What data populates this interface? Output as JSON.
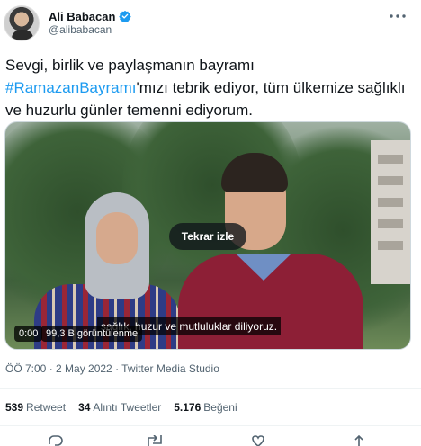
{
  "user": {
    "display_name": "Ali Babacan",
    "handle": "@alibabacan",
    "verified_icon": "verified-badge-icon"
  },
  "tweet": {
    "text_part1": "Sevgi, birlik ve paylaşmanın bayramı",
    "hashtag": "#RamazanBayramı",
    "text_part2": "'mızı tebrik ediyor, tüm ülkemize sağlıklı ve huzurlu günler temenni ediyorum."
  },
  "video": {
    "replay_label": "Tekrar izle",
    "caption": "sağlık, huzur ve mutluluklar diliyoruz.",
    "time": "0:00",
    "views": "99,3 B görüntülenme"
  },
  "meta": "ÖÖ 7:00 · 2 May 2022 · Twitter Media Studio",
  "stats": {
    "retweets_count": "539",
    "retweets_label": "Retweet",
    "quotes_count": "34",
    "quotes_label": "Alıntı Tweetler",
    "likes_count": "5.176",
    "likes_label": "Beğeni"
  },
  "colors": {
    "accent": "#1d9bf0",
    "text": "#0f1419",
    "secondary": "#536471"
  },
  "actions": [
    "reply-icon",
    "retweet-icon",
    "like-icon",
    "share-icon"
  ]
}
